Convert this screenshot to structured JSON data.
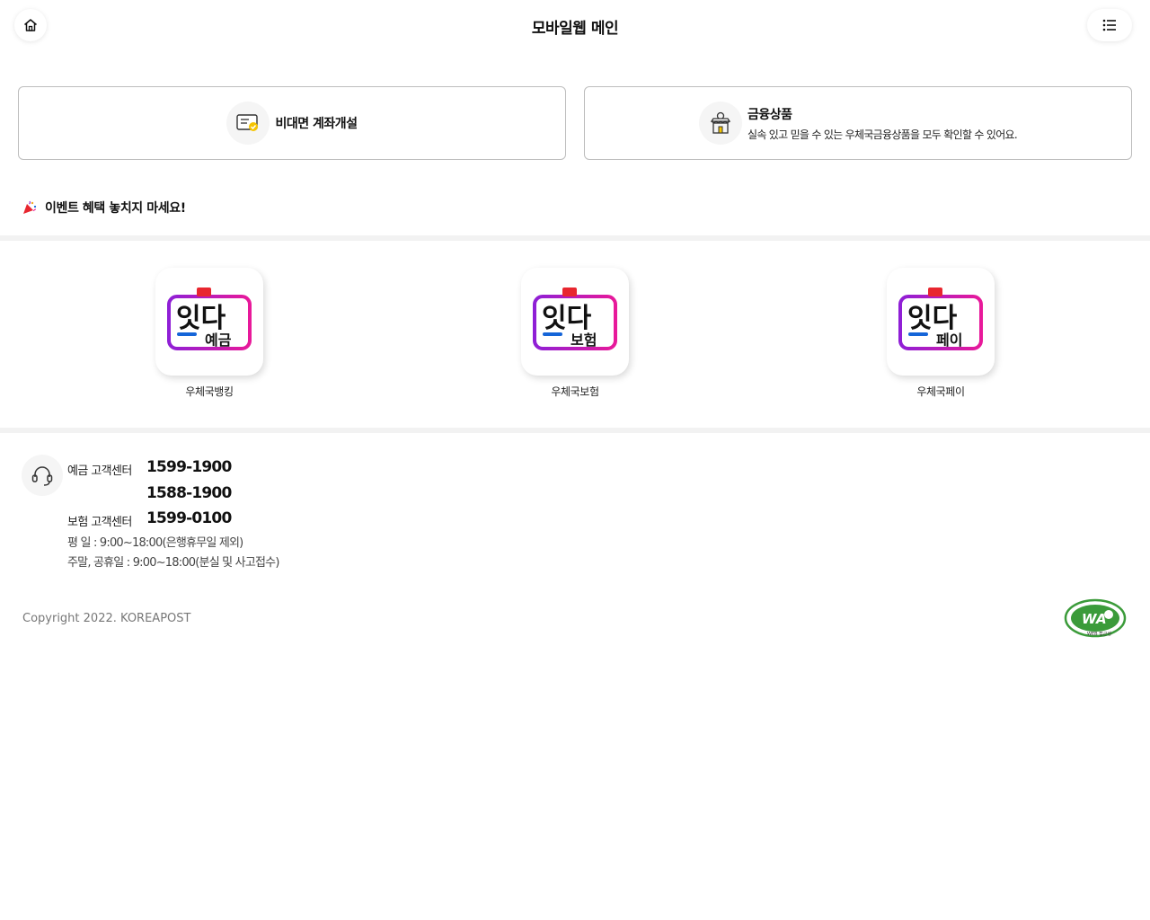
{
  "header": {
    "title": "모바일웹 메인",
    "home_icon": "home-icon",
    "menu_icon": "list-menu-icon"
  },
  "cards": [
    {
      "title": "비대면 계좌개설",
      "icon": "document-check-icon"
    },
    {
      "title": "금융상품",
      "description": "실속 있고 믿을 수 있는 우체국금융상품을 모두 확인할 수 있어요.",
      "icon": "store-icon"
    }
  ],
  "event": {
    "text": "이벤트 혜택 놓치지 마세요!",
    "icon": "party-popper-icon"
  },
  "apps": [
    {
      "label": "우체국뱅킹",
      "logo_main": "잇다",
      "logo_sub": "예금"
    },
    {
      "label": "우체국보험",
      "logo_main": "잇다",
      "logo_sub": "보험"
    },
    {
      "label": "우체국페이",
      "logo_main": "잇다",
      "logo_sub": "페이"
    }
  ],
  "customer_center": {
    "icon": "headset-icon",
    "deposit_label": "예금 고객센터",
    "deposit_phone_1": "1599-1900",
    "deposit_phone_2": "1588-1900",
    "insurance_label": "보험 고객센터",
    "insurance_phone": "1599-0100",
    "weekday_hours": "평 일 : 9:00~18:00(은행휴무일 제외)",
    "weekend_hours": "주말, 공휴일 : 9:00~18:00(분실 및 사고접수)"
  },
  "footer": {
    "copyright": "Copyright 2022. KOREAPOST",
    "wa_logo": "WA",
    "wa_sub": "WEB 접근성"
  },
  "colors": {
    "logo_red": "#e8262f",
    "logo_pink": "#e8199a",
    "logo_purple": "#8f1fd6",
    "logo_blue": "#1565d8",
    "wa_green": "#3b9b3a"
  }
}
